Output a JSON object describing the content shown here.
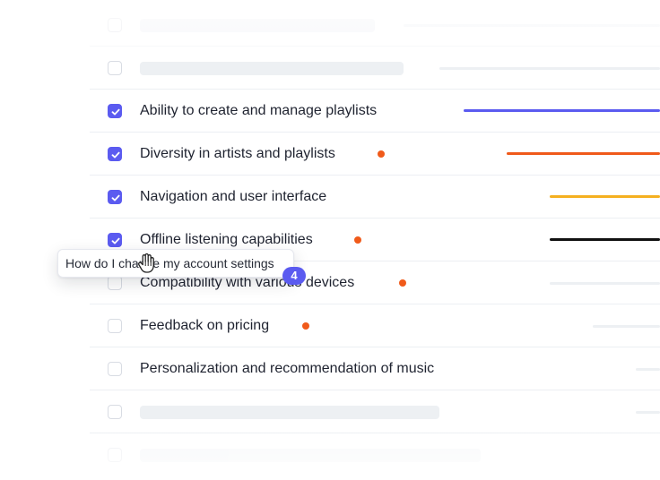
{
  "list": {
    "items": [
      {
        "label": "Ability to create and manage playlists",
        "checked": true,
        "bar_color": "#5b5bf0"
      },
      {
        "label": "Diversity in artists and playlists",
        "checked": true,
        "bar_color": "#f05a1a",
        "dot_color": "#f05a1a"
      },
      {
        "label": "Navigation and user interface",
        "checked": true,
        "bar_color": "#f5b020"
      },
      {
        "label": "Offline listening capabilities",
        "checked": true,
        "bar_color": "#111111",
        "dot_color": "#f05a1a"
      },
      {
        "label": "Compatibility with various devices",
        "checked": false,
        "dot_color": "#f05a1a"
      },
      {
        "label": "Feedback on pricing",
        "checked": false,
        "dot_color": "#f05a1a"
      },
      {
        "label": "Personalization and recommendation of music",
        "checked": false
      }
    ]
  },
  "tooltip": {
    "text": "How do I change my account settings",
    "badge_count": "4",
    "icon": "hand-pointer-icon"
  },
  "colors": {
    "accent": "#5b5bf0",
    "dot": "#f05a1a"
  }
}
